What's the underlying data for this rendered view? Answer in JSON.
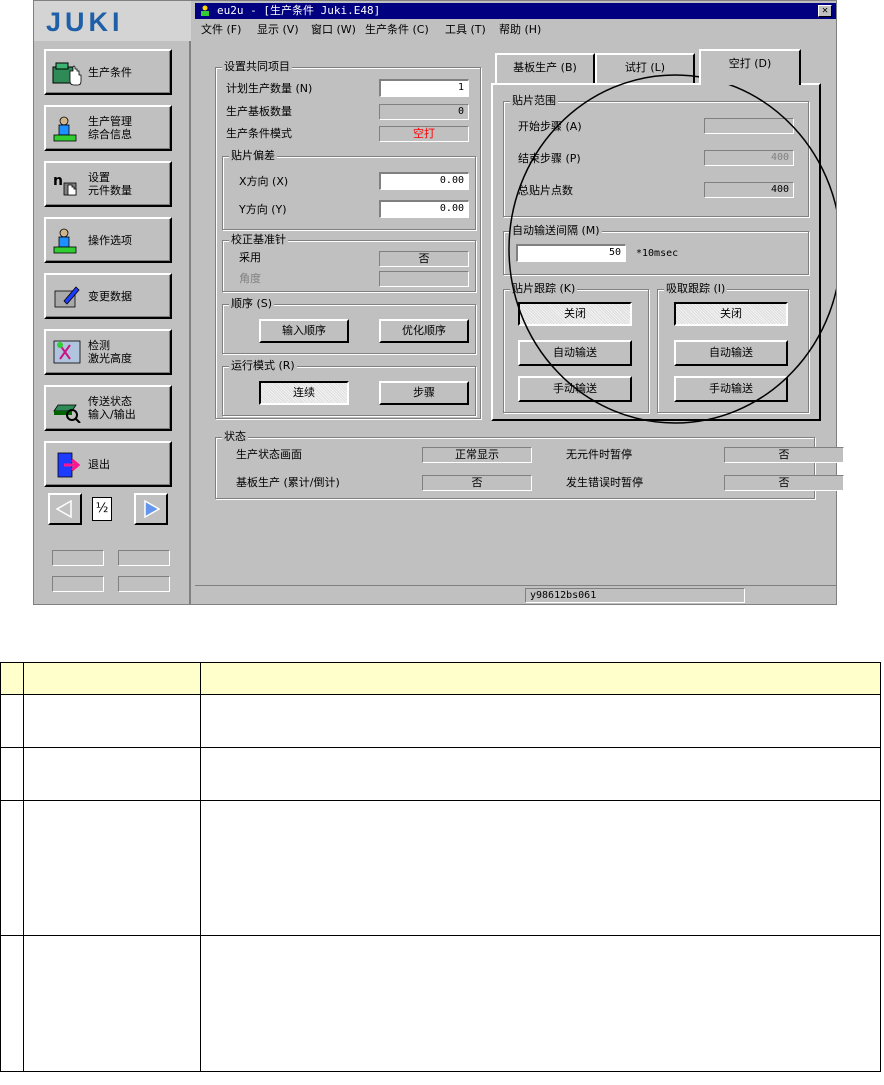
{
  "left_panel": {
    "logo": "JUKI",
    "nav_buttons": [
      {
        "label": "生产条件",
        "icon": "production-conditions-icon"
      },
      {
        "label": "生产管理\n综合信息",
        "icon": "production-management-icon"
      },
      {
        "label": "设置\n元件数量",
        "icon": "set-component-count-icon"
      },
      {
        "label": "操作选项",
        "icon": "operator-options-icon"
      },
      {
        "label": "变更数据",
        "icon": "change-data-icon"
      },
      {
        "label": "检测\n激光高度",
        "icon": "laser-height-icon"
      },
      {
        "label": "传送状态\n输入/输出",
        "icon": "transfer-io-icon"
      },
      {
        "label": "退出",
        "icon": "exit-icon"
      }
    ],
    "pager": {
      "page": "½"
    }
  },
  "window": {
    "title": "eu2u - [生产条件 Juki.E48]",
    "menu": [
      "文件 (F)",
      "显示 (V)",
      "窗口 (W)",
      "生产条件 (C)",
      "工具 (T)",
      "帮助 (H)"
    ]
  },
  "common": {
    "group_title": "设置共同项目",
    "planned_qty_label": "计划生产数量 (N)",
    "planned_qty_value": "1",
    "produced_boards_label": "生产基板数量",
    "produced_boards_value": "0",
    "mode_label": "生产条件模式",
    "mode_value": "空打",
    "offset_group": "贴片偏差",
    "x_label": "X方向 (X)",
    "x_value": "0.00",
    "y_label": "Y方向 (Y)",
    "y_value": "0.00",
    "fiducial_group": "校正基准针",
    "use_label": "采用",
    "use_value": "否",
    "angle_label": "角度",
    "angle_value": "",
    "order_group": "顺序 (S)",
    "input_order": "输入顺序",
    "optimize_order": "优化顺序",
    "run_group": "运行模式 (R)",
    "continuous": "连续",
    "step": "步骤"
  },
  "tabs": [
    "基板生产 (B)",
    "试打 (L)",
    "空打 (D)"
  ],
  "dry_run": {
    "range_group": "贴片范围",
    "start_label": "开始步骤 (A)",
    "start_value": "",
    "end_label": "结束步骤 (P)",
    "end_value": "400",
    "total_label": "总贴片点数",
    "total_value": "400",
    "interval_group": "自动输送间隔 (M)",
    "interval_value": "50",
    "interval_unit": "*10msec",
    "mount_track_group": "贴片跟踪 (K)",
    "pick_track_group": "吸取跟踪 (I)",
    "off": "关闭",
    "auto": "自动输送",
    "manual": "手动输送"
  },
  "status": {
    "group_title": "状态",
    "screen_label": "生产状态画面",
    "screen_value": "正常显示",
    "board_label": "基板生产 (累计/倒计)",
    "board_value": "否",
    "no_parts_label": "无元件时暂停",
    "no_parts_value": "否",
    "error_label": "发生错误时暂停",
    "error_value": "否"
  },
  "statusbar": "y98612bs061",
  "colors": {
    "title_bar": "#000080",
    "face": "#c0c0c0",
    "table_header": "#ffffcc",
    "mode_red": "#ff0000"
  }
}
